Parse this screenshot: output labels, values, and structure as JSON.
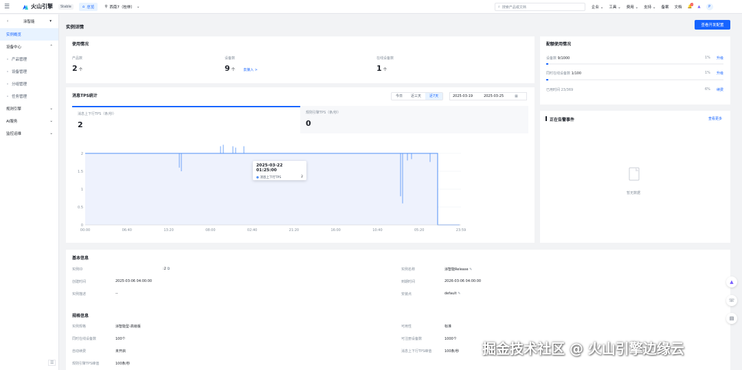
{
  "topbar": {
    "logo_text": "火山引擎",
    "env_badge": "Stable",
    "overview_tab": "总览",
    "region": "西南7（桂林）",
    "search_placeholder": "搜索产品或文档",
    "nav": [
      "企业",
      "工具",
      "费用",
      "支持",
      "备案",
      "文档"
    ],
    "notification_count": "3",
    "avatar_letter": "P"
  },
  "sidebar": {
    "product": "涂智能",
    "items": [
      {
        "label": "实例概览",
        "active": true
      },
      {
        "label": "设备中心",
        "expanded": true,
        "children": [
          "产品管理",
          "设备管理",
          "分组管理",
          "任务管理"
        ]
      },
      {
        "label": "规则引擎"
      },
      {
        "label": "AI服务"
      },
      {
        "label": "监控运维"
      }
    ]
  },
  "page": {
    "title": "实例详情",
    "primary_button": "查看开发配置"
  },
  "usage": {
    "title": "使用情况",
    "stats": [
      {
        "label": "产品数",
        "value": "2",
        "unit": "个"
      },
      {
        "label": "设备数",
        "value": "9",
        "unit": "个",
        "link": "去接入 >"
      },
      {
        "label": "在线设备数",
        "value": "1",
        "unit": "个"
      }
    ]
  },
  "quota": {
    "title": "配额使用情况",
    "rows": [
      {
        "label": "设备数",
        "value": "9/1000",
        "pct": "1%",
        "action": "升级"
      },
      {
        "label": "同时在线设备数",
        "value": "1/100",
        "pct": "1%",
        "action": "升级"
      },
      {
        "label": "已用时间",
        "value": "23/369",
        "pct": "6%",
        "action": "续费"
      }
    ]
  },
  "tps": {
    "title": "消息TPS统计",
    "ranges": [
      "今日",
      "近三天",
      "近7天"
    ],
    "active_range": "近7天",
    "date_start": "2025-03-19",
    "date_end": "2025-03-25",
    "metrics": [
      {
        "label": "消息上下行TPS（条/秒）",
        "value": "2"
      },
      {
        "label": "规则引擎TPS（条/秒）",
        "value": "0"
      }
    ],
    "tooltip_time": "2025-03-22 01:25:00",
    "tooltip_series": "消息上下行TPS",
    "tooltip_value": "2"
  },
  "chart_data": {
    "type": "area",
    "series": [
      {
        "name": "消息上下行TPS",
        "values": [
          2,
          2,
          2,
          2,
          2,
          2,
          2,
          2,
          2,
          2,
          2,
          2,
          2,
          2,
          2,
          2,
          2,
          2,
          2,
          2,
          2,
          2,
          2,
          2,
          2,
          2,
          2,
          2,
          2,
          2,
          2,
          2,
          2,
          2,
          2,
          0,
          0,
          0
        ]
      }
    ],
    "x_tick_labels": [
      "00:00",
      "06:40",
      "13:20",
      "08:00",
      "02:40",
      "21:20",
      "16:00",
      "10:40",
      "05:20",
      "23:59"
    ],
    "y_ticks": [
      "0",
      "0.5",
      "1",
      "1.5",
      "2"
    ],
    "ylim": [
      0,
      2.2
    ],
    "color": "#4e8ef5"
  },
  "alerts": {
    "title": "正在告警事件",
    "more": "查看更多",
    "empty": "暂无数据"
  },
  "basic": {
    "title": "基本信息",
    "left": [
      {
        "label": "实例ID",
        "value": ":2"
      },
      {
        "label": "创建时间",
        "value": "2025-03-06 04:00:00"
      },
      {
        "label": "实例描述",
        "value": "--"
      }
    ],
    "right": [
      {
        "label": "实例名称",
        "value": "涂智能Release"
      },
      {
        "label": "到期时间",
        "value": "2026-03-06 04:00:00"
      },
      {
        "label": "安装点",
        "value": "default"
      }
    ]
  },
  "spec": {
    "title": "规格信息",
    "left": [
      {
        "label": "实例规格",
        "value": "涂智能型-高级版"
      },
      {
        "label": "同时在线设备数",
        "value": "100个"
      },
      {
        "label": "自动续费",
        "value": "未开启"
      },
      {
        "label": "规则引擎TPS峰值",
        "value": "100条/秒"
      }
    ],
    "right": [
      {
        "label": "可用性",
        "value": "标准"
      },
      {
        "label": "可注册设备数",
        "value": "1000个"
      },
      {
        "label": "消息上下行TPS峰值",
        "value": "100条/秒"
      }
    ]
  },
  "watermark": "掘金技术社区 @ 火山引擎边缘云"
}
